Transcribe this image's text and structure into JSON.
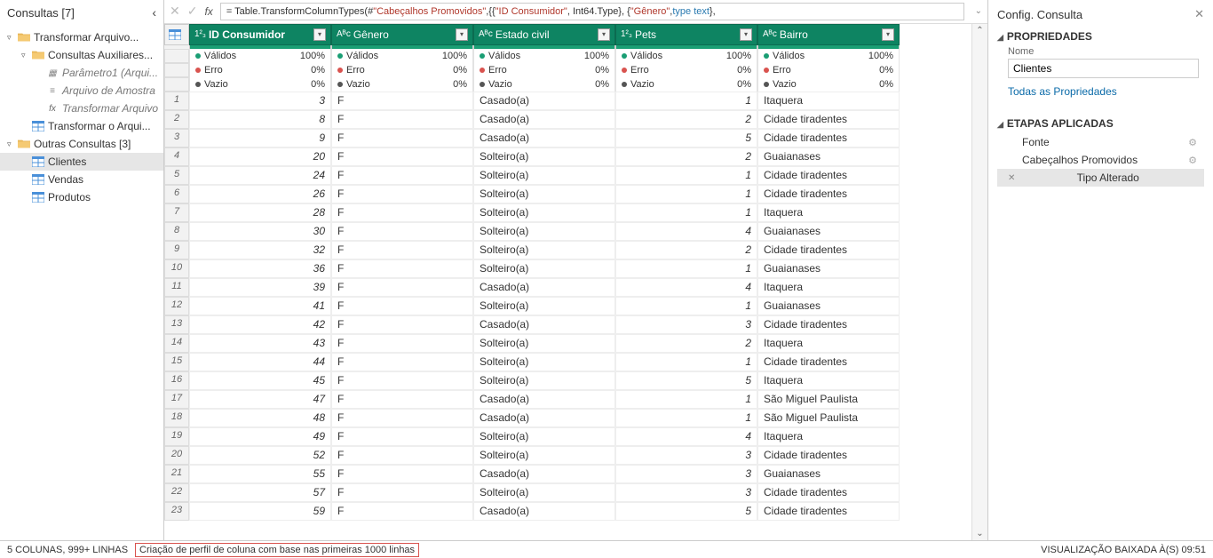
{
  "leftPanel": {
    "title": "Consultas [7]",
    "items": [
      {
        "lvl": 0,
        "caret": "▿",
        "icon": "folder",
        "label": "Transformar Arquivo..."
      },
      {
        "lvl": 1,
        "caret": "▿",
        "icon": "folder",
        "label": "Consultas Auxiliares..."
      },
      {
        "lvl": 2,
        "caret": "",
        "icon": "param",
        "label": "Parâmetro1 (Arqui...",
        "italic": true
      },
      {
        "lvl": 2,
        "caret": "",
        "icon": "file",
        "label": "Arquivo de Amostra",
        "italic": true
      },
      {
        "lvl": 2,
        "caret": "",
        "icon": "fx",
        "label": "Transformar Arquivo",
        "italic": true
      },
      {
        "lvl": 1,
        "caret": "",
        "icon": "table",
        "label": "Transformar o Arqui..."
      },
      {
        "lvl": 0,
        "caret": "▿",
        "icon": "folder",
        "label": "Outras Consultas [3]"
      },
      {
        "lvl": 1,
        "caret": "",
        "icon": "table",
        "label": "Clientes",
        "selected": true
      },
      {
        "lvl": 1,
        "caret": "",
        "icon": "table",
        "label": "Vendas"
      },
      {
        "lvl": 1,
        "caret": "",
        "icon": "table",
        "label": "Produtos"
      }
    ]
  },
  "formula": {
    "prefix": "= Table.TransformColumnTypes(#",
    "s1": "\"Cabeçalhos Promovidos\"",
    "mid1": ",{{",
    "s2": "\"ID Consumidor\"",
    "mid2": ", Int64.Type}, {",
    "s3": "\"Gênero\"",
    "mid3": ", ",
    "kw": "type text",
    "end": "},"
  },
  "columns": [
    {
      "type": "1²₃",
      "name": "ID Consumidor",
      "bold": true
    },
    {
      "type": "Aᴮᴄ",
      "name": "Gênero"
    },
    {
      "type": "Aᴮᴄ",
      "name": "Estado civil"
    },
    {
      "type": "1²₃",
      "name": "Pets"
    },
    {
      "type": "Aᴮᴄ",
      "name": "Bairro"
    }
  ],
  "quality": {
    "labels": [
      "Válidos",
      "Erro",
      "Vazio"
    ],
    "vals": [
      "100%",
      "0%",
      "0%"
    ]
  },
  "rows": [
    {
      "n": 1,
      "id": "3",
      "g": "F",
      "ec": "Casado(a)",
      "p": "1",
      "b": "Itaquera"
    },
    {
      "n": 2,
      "id": "8",
      "g": "F",
      "ec": "Casado(a)",
      "p": "2",
      "b": "Cidade tiradentes"
    },
    {
      "n": 3,
      "id": "9",
      "g": "F",
      "ec": "Casado(a)",
      "p": "5",
      "b": "Cidade tiradentes"
    },
    {
      "n": 4,
      "id": "20",
      "g": "F",
      "ec": "Solteiro(a)",
      "p": "2",
      "b": "Guaianases"
    },
    {
      "n": 5,
      "id": "24",
      "g": "F",
      "ec": "Solteiro(a)",
      "p": "1",
      "b": "Cidade tiradentes"
    },
    {
      "n": 6,
      "id": "26",
      "g": "F",
      "ec": "Solteiro(a)",
      "p": "1",
      "b": "Cidade tiradentes"
    },
    {
      "n": 7,
      "id": "28",
      "g": "F",
      "ec": "Solteiro(a)",
      "p": "1",
      "b": "Itaquera"
    },
    {
      "n": 8,
      "id": "30",
      "g": "F",
      "ec": "Solteiro(a)",
      "p": "4",
      "b": "Guaianases"
    },
    {
      "n": 9,
      "id": "32",
      "g": "F",
      "ec": "Solteiro(a)",
      "p": "2",
      "b": "Cidade tiradentes"
    },
    {
      "n": 10,
      "id": "36",
      "g": "F",
      "ec": "Solteiro(a)",
      "p": "1",
      "b": "Guaianases"
    },
    {
      "n": 11,
      "id": "39",
      "g": "F",
      "ec": "Casado(a)",
      "p": "4",
      "b": "Itaquera"
    },
    {
      "n": 12,
      "id": "41",
      "g": "F",
      "ec": "Solteiro(a)",
      "p": "1",
      "b": "Guaianases"
    },
    {
      "n": 13,
      "id": "42",
      "g": "F",
      "ec": "Casado(a)",
      "p": "3",
      "b": "Cidade tiradentes"
    },
    {
      "n": 14,
      "id": "43",
      "g": "F",
      "ec": "Solteiro(a)",
      "p": "2",
      "b": "Itaquera"
    },
    {
      "n": 15,
      "id": "44",
      "g": "F",
      "ec": "Solteiro(a)",
      "p": "1",
      "b": "Cidade tiradentes"
    },
    {
      "n": 16,
      "id": "45",
      "g": "F",
      "ec": "Solteiro(a)",
      "p": "5",
      "b": "Itaquera"
    },
    {
      "n": 17,
      "id": "47",
      "g": "F",
      "ec": "Casado(a)",
      "p": "1",
      "b": "São Miguel Paulista"
    },
    {
      "n": 18,
      "id": "48",
      "g": "F",
      "ec": "Casado(a)",
      "p": "1",
      "b": "São Miguel Paulista"
    },
    {
      "n": 19,
      "id": "49",
      "g": "F",
      "ec": "Solteiro(a)",
      "p": "4",
      "b": "Itaquera"
    },
    {
      "n": 20,
      "id": "52",
      "g": "F",
      "ec": "Solteiro(a)",
      "p": "3",
      "b": "Cidade tiradentes"
    },
    {
      "n": 21,
      "id": "55",
      "g": "F",
      "ec": "Casado(a)",
      "p": "3",
      "b": "Guaianases"
    },
    {
      "n": 22,
      "id": "57",
      "g": "F",
      "ec": "Solteiro(a)",
      "p": "3",
      "b": "Cidade tiradentes"
    },
    {
      "n": 23,
      "id": "59",
      "g": "F",
      "ec": "Casado(a)",
      "p": "5",
      "b": "Cidade tiradentes"
    }
  ],
  "rightPanel": {
    "title": "Config. Consulta",
    "sec1": "PROPRIEDADES",
    "nameLabel": "Nome",
    "nameValue": "Clientes",
    "allProps": "Todas as Propriedades",
    "sec2": "ETAPAS APLICADAS",
    "steps": [
      {
        "label": "Fonte",
        "gear": true
      },
      {
        "label": "Cabeçalhos Promovidos",
        "gear": true
      },
      {
        "label": "Tipo Alterado",
        "gear": false,
        "sel": true,
        "x": true
      }
    ]
  },
  "status": {
    "cols": "5 COLUNAS, 999+ LINHAS",
    "profile": "Criação de perfil de coluna com base nas primeiras 1000 linhas",
    "right": "VISUALIZAÇÃO BAIXADA À(S) 09:51"
  }
}
